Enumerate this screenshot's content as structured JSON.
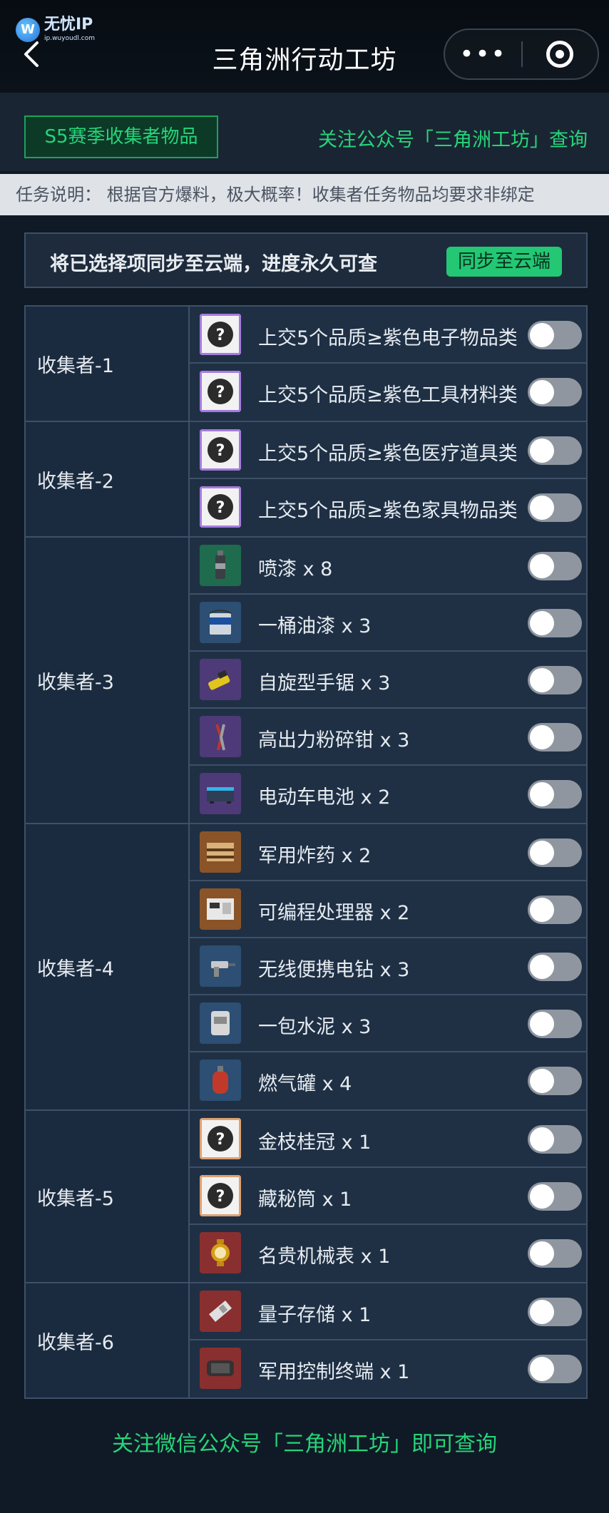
{
  "watermark": {
    "title": "无忧IP",
    "url": "ip.wuyoudl.com",
    "logo_letter": "W"
  },
  "nav": {
    "title": "三角洲行动工坊",
    "back_icon": "chevron-left-icon",
    "more_label": "•••",
    "target_icon": "target-icon"
  },
  "header": {
    "season_label": "S5赛季收集者物品",
    "follow_link": "关注公众号「三角洲工坊」查询"
  },
  "notice": "任务说明：  根据官方爆料，极大概率！收集者任务物品均要求非绑定",
  "sync": {
    "text": "将已选择项同步至云端，进度永久可查",
    "button": "同步至云端"
  },
  "groups": [
    {
      "name": "收集者-1",
      "items": [
        {
          "label": "上交5个品质≥紫色电子物品类",
          "icon": "question-icon",
          "bg": "#3a2f55",
          "border": "#a57be0",
          "on": false
        },
        {
          "label": "上交5个品质≥紫色工具材料类",
          "icon": "question-icon",
          "bg": "#3a2f55",
          "border": "#a57be0",
          "on": false
        }
      ]
    },
    {
      "name": "收集者-2",
      "items": [
        {
          "label": "上交5个品质≥紫色医疗道具类",
          "icon": "question-icon",
          "bg": "#3a2f55",
          "border": "#a57be0",
          "on": false
        },
        {
          "label": "上交5个品质≥紫色家具物品类",
          "icon": "question-icon",
          "bg": "#3a2f55",
          "border": "#a57be0",
          "on": false
        }
      ]
    },
    {
      "name": "收集者-3",
      "items": [
        {
          "label": "喷漆 x 8",
          "icon": "spray-can-icon",
          "bg": "#1f6b4d",
          "on": false
        },
        {
          "label": "一桶油漆 x 3",
          "icon": "paint-bucket-icon",
          "bg": "#2c4f73",
          "on": false
        },
        {
          "label": "自旋型手锯 x 3",
          "icon": "hand-saw-icon",
          "bg": "#4e3a78",
          "on": false
        },
        {
          "label": "高出力粉碎钳 x 3",
          "icon": "pliers-icon",
          "bg": "#4e3a78",
          "on": false
        },
        {
          "label": "电动车电池 x 2",
          "icon": "battery-icon",
          "bg": "#4e3a78",
          "on": false
        }
      ]
    },
    {
      "name": "收集者-4",
      "items": [
        {
          "label": "军用炸药 x 2",
          "icon": "explosive-icon",
          "bg": "#8a5428",
          "on": false
        },
        {
          "label": "可编程处理器 x 2",
          "icon": "processor-icon",
          "bg": "#8a5428",
          "on": false
        },
        {
          "label": "无线便携电钻 x 3",
          "icon": "drill-icon",
          "bg": "#2c4f73",
          "on": false
        },
        {
          "label": "一包水泥 x 3",
          "icon": "cement-bag-icon",
          "bg": "#2c4f73",
          "on": false
        },
        {
          "label": "燃气罐 x 4",
          "icon": "gas-tank-icon",
          "bg": "#2c4f73",
          "on": false
        }
      ]
    },
    {
      "name": "收集者-5",
      "items": [
        {
          "label": "金枝桂冠 x 1",
          "icon": "question-icon",
          "bg": "#6b3a2a",
          "border": "#e0a070",
          "on": false
        },
        {
          "label": "藏秘筒 x 1",
          "icon": "question-icon",
          "bg": "#6b3a2a",
          "border": "#e0a070",
          "on": false
        },
        {
          "label": "名贵机械表 x 1",
          "icon": "watch-icon",
          "bg": "#8a2f2f",
          "on": false
        }
      ]
    },
    {
      "name": "收集者-6",
      "items": [
        {
          "label": "量子存储 x 1",
          "icon": "quantum-storage-icon",
          "bg": "#8a2f2f",
          "on": false
        },
        {
          "label": "军用控制终端 x 1",
          "icon": "control-terminal-icon",
          "bg": "#8a2f2f",
          "on": false
        }
      ]
    }
  ],
  "footer": "关注微信公众号「三角洲工坊」即可查询"
}
